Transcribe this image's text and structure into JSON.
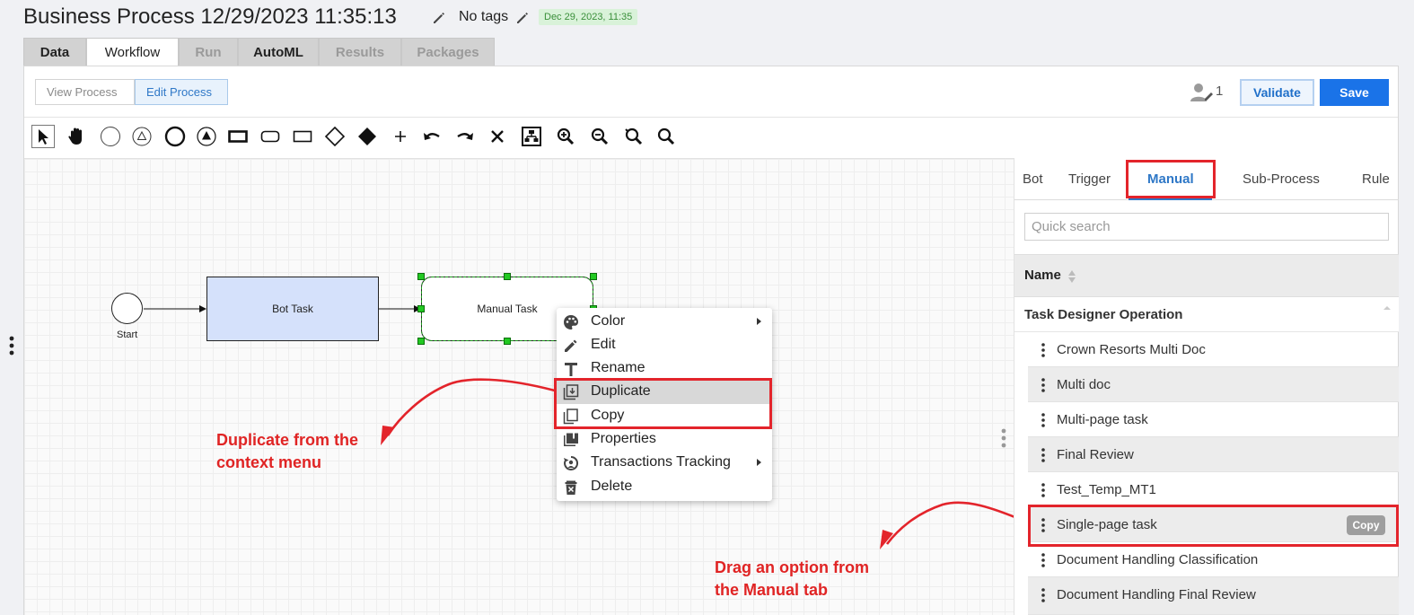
{
  "header": {
    "title": "Business Process 12/29/2023 11:35:13",
    "tags_label": "No tags",
    "date_badge": "Dec 29, 2023, 11:35"
  },
  "tabs": [
    {
      "label": "Data",
      "state": "normal"
    },
    {
      "label": "Workflow",
      "state": "active"
    },
    {
      "label": "Run",
      "state": "disabled"
    },
    {
      "label": "AutoML",
      "state": "normal"
    },
    {
      "label": "Results",
      "state": "disabled"
    },
    {
      "label": "Packages",
      "state": "disabled"
    }
  ],
  "mode_buttons": {
    "view": "View Process",
    "edit": "Edit Process"
  },
  "actions": {
    "users_count": "1",
    "validate": "Validate",
    "save": "Save"
  },
  "toolbar": [
    "pointer-icon",
    "pan-hand-icon",
    "start-event-icon",
    "intermediate-event-icon",
    "end-event-icon",
    "timer-event-icon",
    "task-icon",
    "rounded-task-icon",
    "subprocess-icon",
    "gateway-icon",
    "filled-gateway-icon",
    "plus-icon",
    "undo-icon",
    "redo-icon",
    "delete-icon",
    "layout-icon",
    "zoom-in-icon",
    "zoom-out-icon",
    "zoom-fit-icon",
    "zoom-actual-icon"
  ],
  "canvas": {
    "start_label": "Start",
    "bot_task_label": "Bot Task",
    "manual_task_label": "Manual Task"
  },
  "context_menu": [
    {
      "label": "Color",
      "icon": "palette-icon",
      "submenu": true
    },
    {
      "label": "Edit",
      "icon": "pencil-icon",
      "submenu": false
    },
    {
      "label": "Rename",
      "icon": "text-icon",
      "submenu": false
    },
    {
      "label": "Duplicate",
      "icon": "duplicate-icon",
      "submenu": false
    },
    {
      "label": "Copy",
      "icon": "copy-icon",
      "submenu": false
    },
    {
      "label": "Properties",
      "icon": "properties-icon",
      "submenu": false
    },
    {
      "label": "Transactions Tracking",
      "icon": "tracking-icon",
      "submenu": true
    },
    {
      "label": "Delete",
      "icon": "trash-icon",
      "submenu": false
    }
  ],
  "annotations": {
    "duplicate_line1": "Duplicate from the",
    "duplicate_line2": "context menu",
    "drag_line1": "Drag an option from",
    "drag_line2": "the Manual tab"
  },
  "right_panel": {
    "tabs": [
      "Bot",
      "Trigger",
      "Manual",
      "Sub-Process",
      "Rule"
    ],
    "active_tab": "Manual",
    "search_placeholder": "Quick search",
    "name_header": "Name",
    "group": "Task Designer Operation",
    "items": [
      "Crown Resorts Multi Doc",
      "Multi doc",
      "Multi-page task",
      "Final Review",
      "Test_Temp_MT1",
      "Single-page task",
      "Document Handling Classification",
      "Document Handling Final Review"
    ],
    "copy_badge": "Copy"
  },
  "colors": {
    "accent": "#1a73e8",
    "annotation_red": "#e3242b",
    "bot_task_fill": "#d5e1fb",
    "selection_green": "#22c922"
  }
}
